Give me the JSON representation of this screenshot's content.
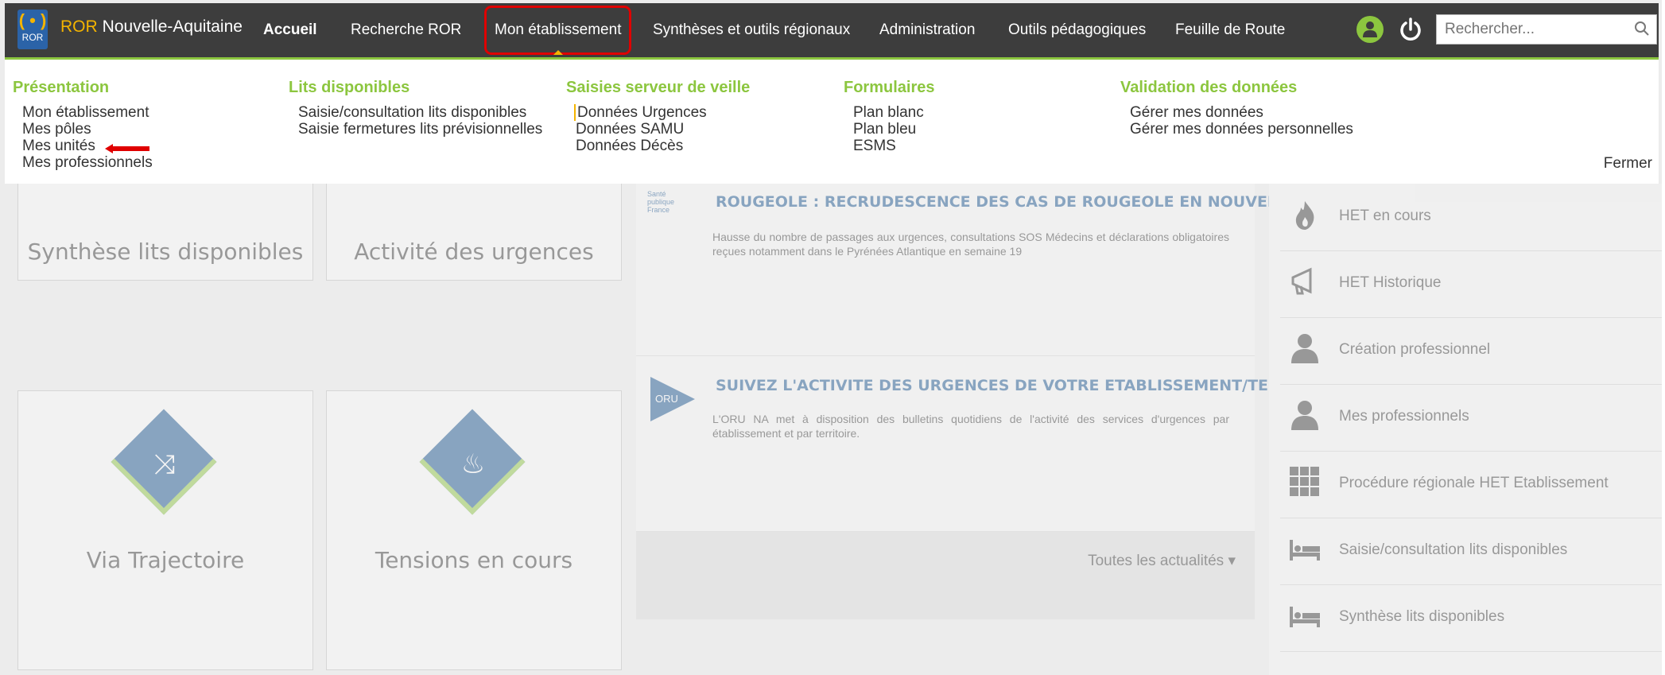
{
  "brand": {
    "logo_text": "ROR",
    "ror": "ROR",
    "name": "Nouvelle-Aquitaine"
  },
  "nav": {
    "items": [
      "Accueil",
      "Recherche ROR",
      "Mon établissement",
      "Synthèses et outils régionaux",
      "Administration",
      "Outils pédagogiques",
      "Feuille de Route"
    ],
    "active": "Mon établissement"
  },
  "search": {
    "placeholder": "Rechercher..."
  },
  "menu": {
    "columns": [
      {
        "title": "Présentation",
        "links": [
          "Mon établissement",
          "Mes pôles",
          "Mes unités",
          "Mes professionnels"
        ]
      },
      {
        "title": "Lits disponibles",
        "links": [
          "Saisie/consultation lits disponibles",
          "Saisie fermetures lits prévisionnelles"
        ]
      },
      {
        "title": "Saisies serveur de veille",
        "links": [
          "Données Urgences",
          "Données SAMU",
          "Données Décès"
        ]
      },
      {
        "title": "Formulaires",
        "links": [
          "Plan blanc",
          "Plan bleu",
          "ESMS"
        ]
      },
      {
        "title": "Validation des données",
        "links": [
          "Gérer mes données",
          "Gérer mes données personnelles"
        ]
      }
    ],
    "close_label": "Fermer"
  },
  "tiles": [
    "Synthèse lits disponibles",
    "Activité des urgences",
    "Via Trajectoire",
    "Tensions en cours"
  ],
  "news": {
    "items": [
      {
        "title": "ROUGEOLE : RECRUDESCENCE DES CAS DE ROUGEOLE EN NOUVEL...",
        "text": "Hausse du nombre de passages aux urgences, consultations SOS Médecins et déclarations obligatoires reçues notamment dans le Pyrénées Atlantique en semaine 19",
        "logo": "Santé publique France"
      },
      {
        "title": "SUIVEZ L'ACTIVITE DES URGENCES DE VOTRE ETABLISSEMENT/TER...",
        "text": "L'ORU NA met à disposition des bulletins quotidiens de l'activité des services d'urgences par établissement et par territoire.",
        "logo": "ORU"
      }
    ],
    "all_label": "Toutes les actualités"
  },
  "sidebar": {
    "items": [
      {
        "label": "HET en cours",
        "icon": "fire-icon"
      },
      {
        "label": "HET Historique",
        "icon": "megaphone-icon"
      },
      {
        "label": "Création professionnel",
        "icon": "user-icon"
      },
      {
        "label": "Mes professionnels",
        "icon": "user-icon"
      },
      {
        "label": "Procédure régionale HET Etablissement",
        "icon": "grid-icon"
      },
      {
        "label": "Saisie/consultation lits disponibles",
        "icon": "bed-icon"
      },
      {
        "label": "Synthèse lits disponibles",
        "icon": "bed-icon"
      }
    ]
  },
  "colors": {
    "topbar": "#3d3d3d",
    "accent_green": "#8cc63f",
    "brand_yellow": "#f4b400",
    "highlight_red": "#e00000",
    "tile_blue": "#114e8c"
  }
}
